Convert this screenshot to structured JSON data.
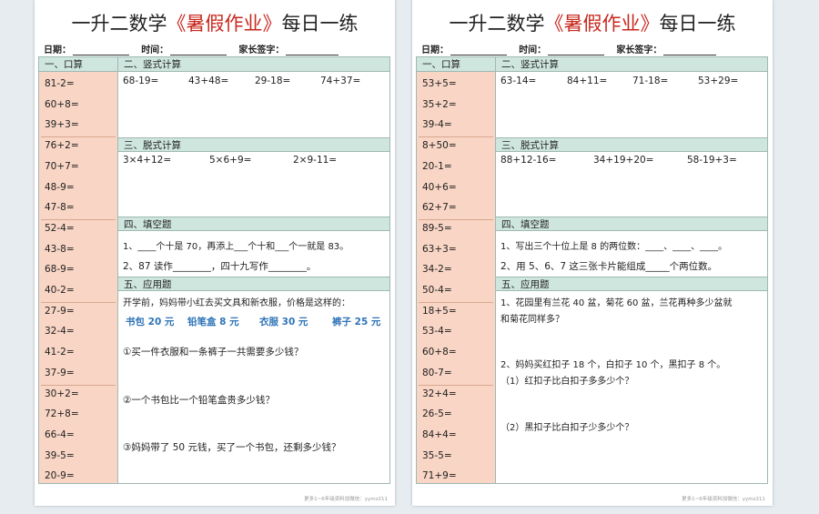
{
  "left": {
    "title_prefix": "一升二数学",
    "title_highlight": "《暑假作业》",
    "title_suffix": "每日一练",
    "header": {
      "date": "日期：",
      "time": "时间：",
      "sign": "家长签字："
    },
    "oral_head": "一、口算",
    "oral": [
      "81-2=",
      "60+8=",
      "39+3=",
      "76+2=",
      "70+7=",
      "48-9=",
      "47-8=",
      "52-4=",
      "43-8=",
      "68-9=",
      "40-2=",
      "27-9=",
      "32-4=",
      "41-2=",
      "37-9=",
      "30+2=",
      "72+8=",
      "66-4=",
      "39-5=",
      "20-9="
    ],
    "vertical_head": "二、竖式计算",
    "vertical": [
      "68-19=",
      "43+48=",
      "29-18=",
      "74+37="
    ],
    "off_head": "三、脱式计算",
    "off": [
      "3×4+12=",
      "5×6+9=",
      "2×9-11="
    ],
    "fill_head": "四、填空题",
    "fill_1": "1、____个十是 70，再添上___个十和___个一就是 83。",
    "fill_2": "2、87 读作________，四十九写作________。",
    "app_head": "五、应用题",
    "app_intro": "开学前，妈妈带小红去买文具和新衣服，价格是这样的：",
    "prices": [
      "书包 20 元",
      "铅笔盒 8 元",
      "衣服 30 元",
      "裤子 25 元"
    ],
    "q1": "①买一件衣服和一条裤子一共需要多少钱？",
    "q2": "②一个书包比一个铅笔盒贵多少钱？",
    "q3": "③妈妈带了 50 元钱，买了一个书包，还剩多少钱？",
    "footer": "更多1~6年级资料加微信：yymz211"
  },
  "right": {
    "title_prefix": "一升二数学",
    "title_highlight": "《暑假作业》",
    "title_suffix": "每日一练",
    "header": {
      "date": "日期：",
      "time": "时间：",
      "sign": "家长签字："
    },
    "oral_head": "一、口算",
    "oral": [
      "53+5=",
      "35+2=",
      "39-4=",
      "8+50=",
      "20-1=",
      "40+6=",
      "62+7=",
      "89-5=",
      "63+3=",
      "34-2=",
      "50-4=",
      "18+5=",
      "53-4=",
      "60+8=",
      "80-7=",
      "32+4=",
      "26-5=",
      "84+4=",
      "35-5=",
      "71+9="
    ],
    "vertical_head": "二、竖式计算",
    "vertical": [
      "63-14=",
      "84+11=",
      "71-18=",
      "53+29="
    ],
    "off_head": "三、脱式计算",
    "off": [
      "88+12-16=",
      "34+19+20=",
      "58-19+3="
    ],
    "fill_head": "四、填空题",
    "fill_1": "1、写出三个十位上是 8 的两位数：____、____、____。",
    "fill_2": "2、用 5、6、7 这三张卡片能组成_____个两位数。",
    "app_head": "五、应用题",
    "app_1a": "1、花园里有兰花 40 盆，菊花 60 盆，兰花再种多少盆就",
    "app_1b": "和菊花同样多？",
    "app_2": "2、妈妈买红扣子 18 个，白扣子 10 个，黑扣子 8 个。",
    "app_2a": "（1）红扣子比白扣子多多少个？",
    "app_2b": "（2）黑扣子比白扣子少多少个？",
    "footer": "更多1~6年级资料加微信：yymz211"
  }
}
